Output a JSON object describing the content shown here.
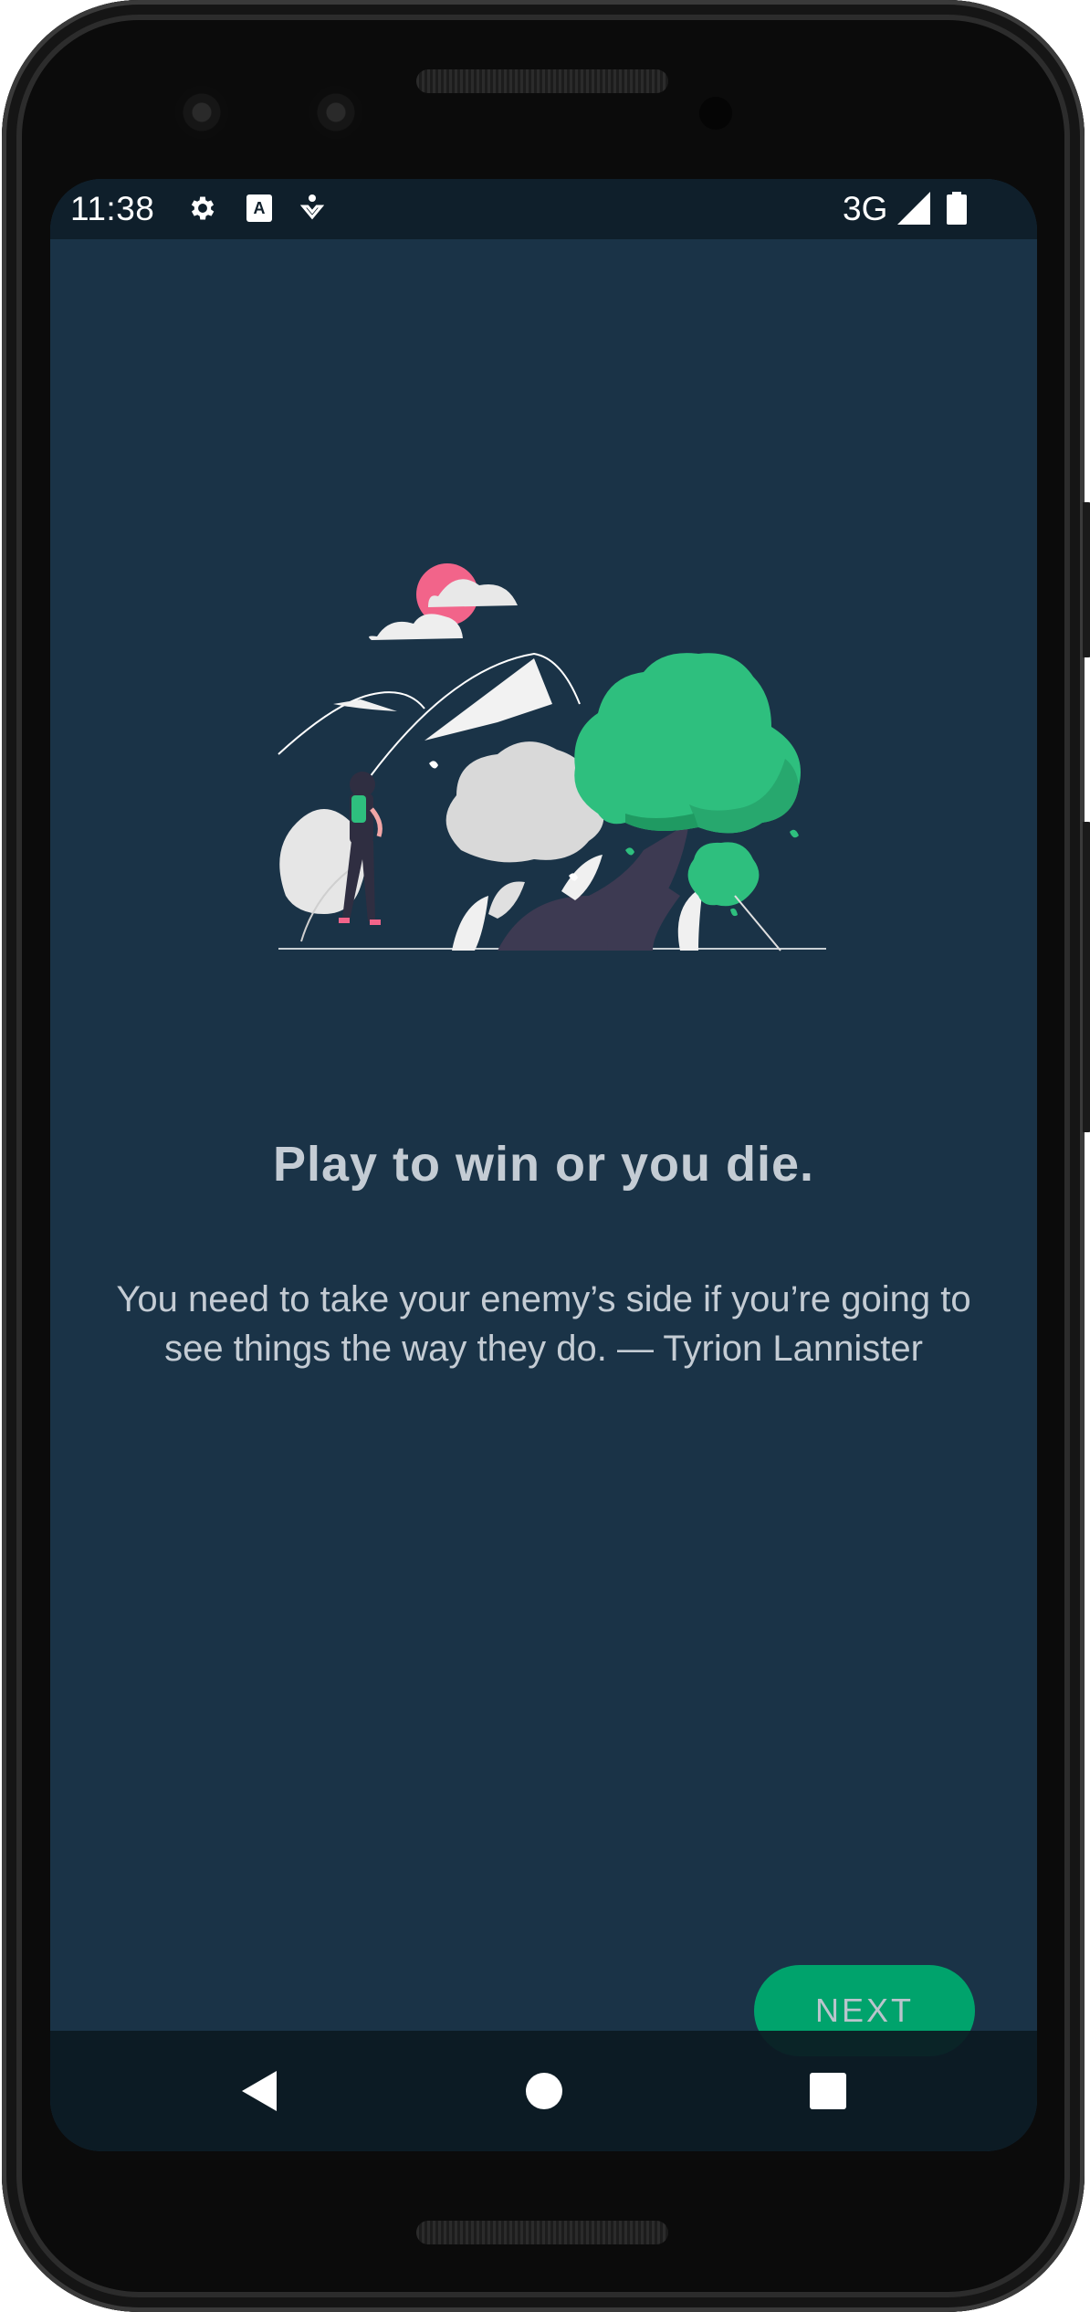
{
  "status_bar": {
    "time": "11:38",
    "network": "3G",
    "icons": [
      "gear-icon",
      "font-a-icon",
      "accessibility-icon",
      "signal-icon",
      "battery-icon"
    ]
  },
  "onboarding": {
    "title": "Play to win or you die.",
    "quote": "You need to take your enemy’s side if you’re going to see things the way they do. — Tyrion Lannister",
    "next_label": "NEXT"
  },
  "nav_bar": {
    "icons": [
      "back-icon",
      "home-icon",
      "recents-icon"
    ]
  },
  "colors": {
    "background": "#1a3347",
    "accent": "#00a36c",
    "text": "#c4ccd4",
    "tree_green": "#2ebf7e",
    "sun_pink": "#f2648a"
  }
}
